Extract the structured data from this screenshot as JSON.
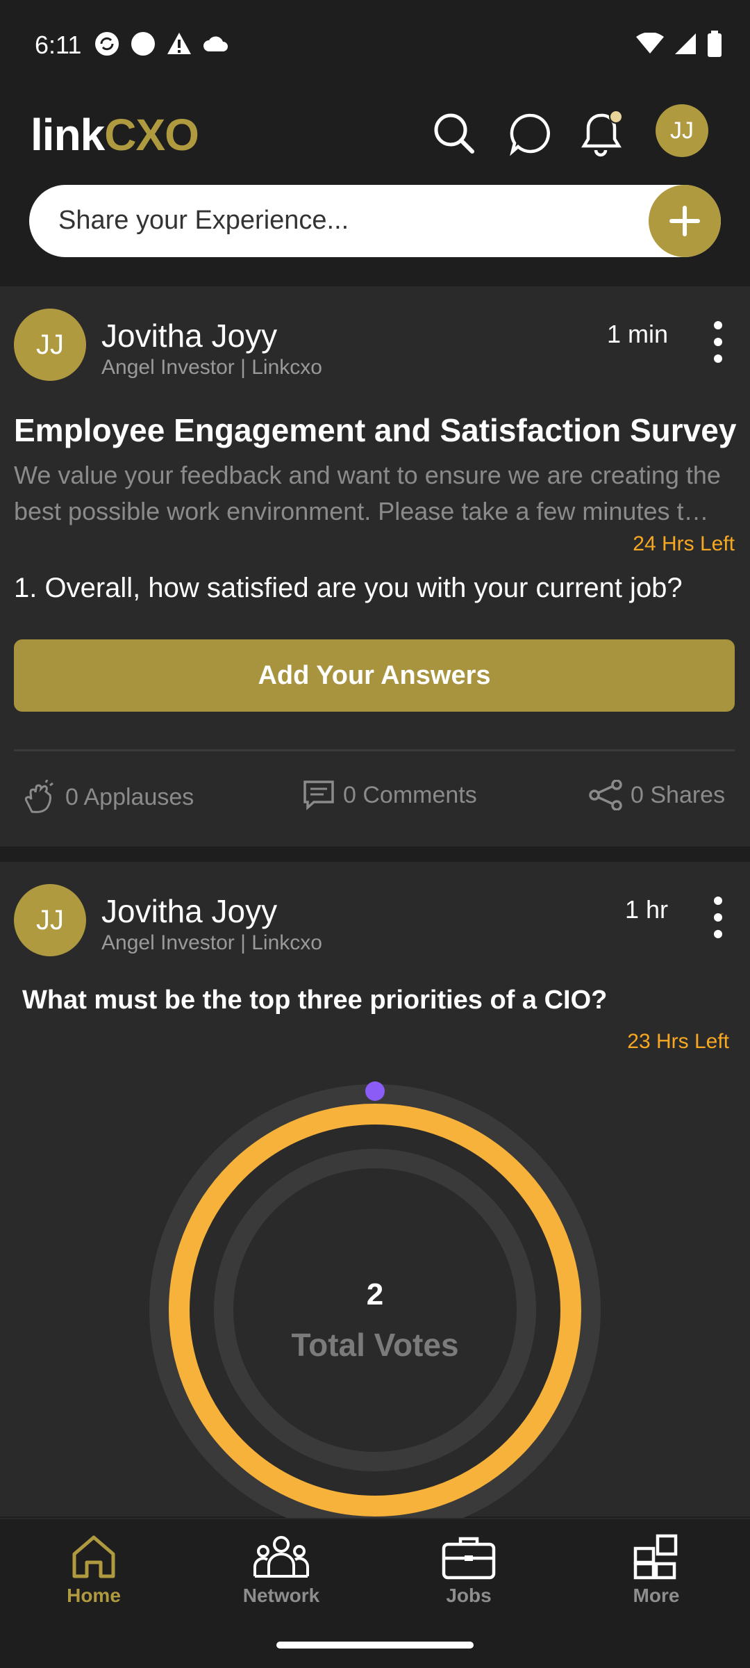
{
  "status": {
    "time": "6:11"
  },
  "header": {
    "logo_left": "link",
    "logo_right": "CXO",
    "avatar_initials": "JJ",
    "share_placeholder": "Share your Experience..."
  },
  "post1": {
    "avatar_initials": "JJ",
    "author": "Jovitha Joyy",
    "role": "Angel Investor | Linkcxo",
    "time": "1 min",
    "title": "Employee Engagement and Satisfaction Survey",
    "description": "We value your feedback and want to ensure we are creating the best possible work environment. Please take a few minutes t…",
    "time_left": "24 Hrs Left",
    "question": "1. Overall, how satisfied are you with your current job?",
    "cta": "Add Your Answers",
    "applauses": "0 Applauses",
    "comments": "0 Comments",
    "shares": "0 Shares"
  },
  "post2": {
    "avatar_initials": "JJ",
    "author": "Jovitha Joyy",
    "role": "Angel Investor | Linkcxo",
    "time": "1 hr",
    "question": "What must be the top three priorities of a CIO?",
    "time_left": "23 Hrs Left",
    "total_votes_value": "2",
    "total_votes_label": "Total Votes"
  },
  "nav": {
    "items": [
      {
        "label": "Home",
        "icon": "home-icon",
        "active": true
      },
      {
        "label": "Network",
        "icon": "network-icon",
        "active": false
      },
      {
        "label": "Jobs",
        "icon": "briefcase-icon",
        "active": false
      },
      {
        "label": "More",
        "icon": "grid-icon",
        "active": false
      }
    ]
  },
  "colors": {
    "accent": "#b09a3f",
    "orange": "#f7a823",
    "purple": "#8b5cf6",
    "background": "#1e1e1e",
    "card": "#2a2a2a"
  }
}
